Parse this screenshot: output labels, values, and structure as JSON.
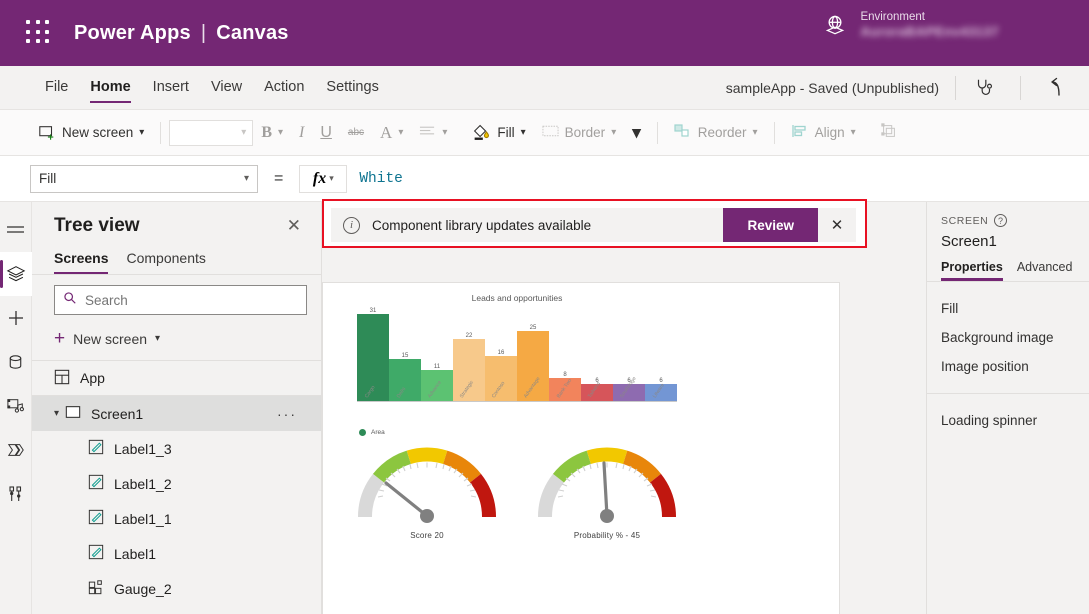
{
  "titlebar": {
    "brand": "Power Apps",
    "separator": "|",
    "product": "Canvas",
    "env_label": "Environment",
    "env_value": "AuroraBAPEnv43137",
    "waffle_icon": "app-launcher-icon",
    "globe_icon": "environment-globe-icon"
  },
  "menubar": {
    "items": [
      {
        "label": "File",
        "active": false
      },
      {
        "label": "Home",
        "active": true
      },
      {
        "label": "Insert",
        "active": false
      },
      {
        "label": "View",
        "active": false
      },
      {
        "label": "Action",
        "active": false
      },
      {
        "label": "Settings",
        "active": false
      }
    ],
    "save_status": "sampleApp - Saved (Unpublished)",
    "checker_icon": "app-checker-stethoscope-icon",
    "undo_icon": "undo-arrow-icon"
  },
  "ribbon": {
    "new_screen": "New screen",
    "font_placeholder": "",
    "bold": "B",
    "italic": "I",
    "underline": "U",
    "strikethrough": "abc",
    "font_color": "A",
    "align": "align-icon",
    "fill": "Fill",
    "border": "Border",
    "more": "more-chevron",
    "reorder": "Reorder",
    "align_group": "Align",
    "group": "group-icon"
  },
  "formulabar": {
    "property": "Fill",
    "equals": "=",
    "fx": "fx",
    "value": "White"
  },
  "rail": {
    "items": [
      {
        "name": "hamburger-menu-icon",
        "selected": false
      },
      {
        "name": "tree-view-layers-icon",
        "selected": true
      },
      {
        "name": "insert-plus-icon",
        "selected": false
      },
      {
        "name": "data-cylinder-icon",
        "selected": false
      },
      {
        "name": "media-icon",
        "selected": false
      },
      {
        "name": "power-automate-icon",
        "selected": false
      },
      {
        "name": "variables-tools-icon",
        "selected": false
      }
    ]
  },
  "treeview": {
    "title": "Tree view",
    "close": "✕",
    "tabs": [
      {
        "label": "Screens",
        "active": true
      },
      {
        "label": "Components",
        "active": false
      }
    ],
    "search_placeholder": "Search",
    "search_value": "",
    "new_screen": "New screen",
    "app_item": "App",
    "screen_item": "Screen1",
    "children": [
      "Label1_3",
      "Label1_2",
      "Label1_1",
      "Label1",
      "Gauge_2"
    ],
    "overflow": "···"
  },
  "banner": {
    "message": "Component library updates available",
    "review_label": "Review",
    "close_label": "✕",
    "info_icon": "info-circle-icon",
    "highlight_color": "#e81123",
    "accent_color": "#742774"
  },
  "properties": {
    "kicker": "SCREEN",
    "name": "Screen1",
    "tabs": [
      {
        "label": "Properties",
        "active": true
      },
      {
        "label": "Advanced",
        "active": false
      }
    ],
    "group1": [
      "Fill",
      "Background image",
      "Image position"
    ],
    "group2": [
      "Loading spinner"
    ]
  },
  "chart_data": [
    {
      "type": "bar",
      "title": "Leads and opportunities",
      "xlabel": "",
      "ylabel": "",
      "ylim": [
        0,
        33
      ],
      "grid": false,
      "legend_position": "bottom-left",
      "legend": [
        "Area"
      ],
      "categories": [
        "Cargo",
        "Delhi",
        "Advance",
        "Strategic",
        "Contoso",
        "Advantage",
        "Bank Two",
        "Tailwind",
        "Southridge",
        "Litware"
      ],
      "values": [
        31,
        15,
        11,
        22,
        16,
        25,
        8,
        6,
        6,
        6
      ],
      "colors": [
        "#2e8b57",
        "#3faa68",
        "#5cc272",
        "#f7c98b",
        "#f6bd6e",
        "#f5a944",
        "#f2845c",
        "#d6555a",
        "#8e6bb0",
        "#7396d4"
      ]
    },
    {
      "type": "gauge",
      "title": "Score",
      "caption": "Score    20",
      "value": 20,
      "min": 0,
      "max": 100,
      "bands": [
        "#d9d9d9",
        "#8cc63f",
        "#f2c800",
        "#e8860a",
        "#c0170f"
      ]
    },
    {
      "type": "gauge",
      "title": "Probability %",
      "caption": "Probability %  -   45",
      "value": 45,
      "min": 0,
      "max": 100,
      "bands": [
        "#d9d9d9",
        "#8cc63f",
        "#f2c800",
        "#e8860a",
        "#c0170f"
      ]
    }
  ]
}
